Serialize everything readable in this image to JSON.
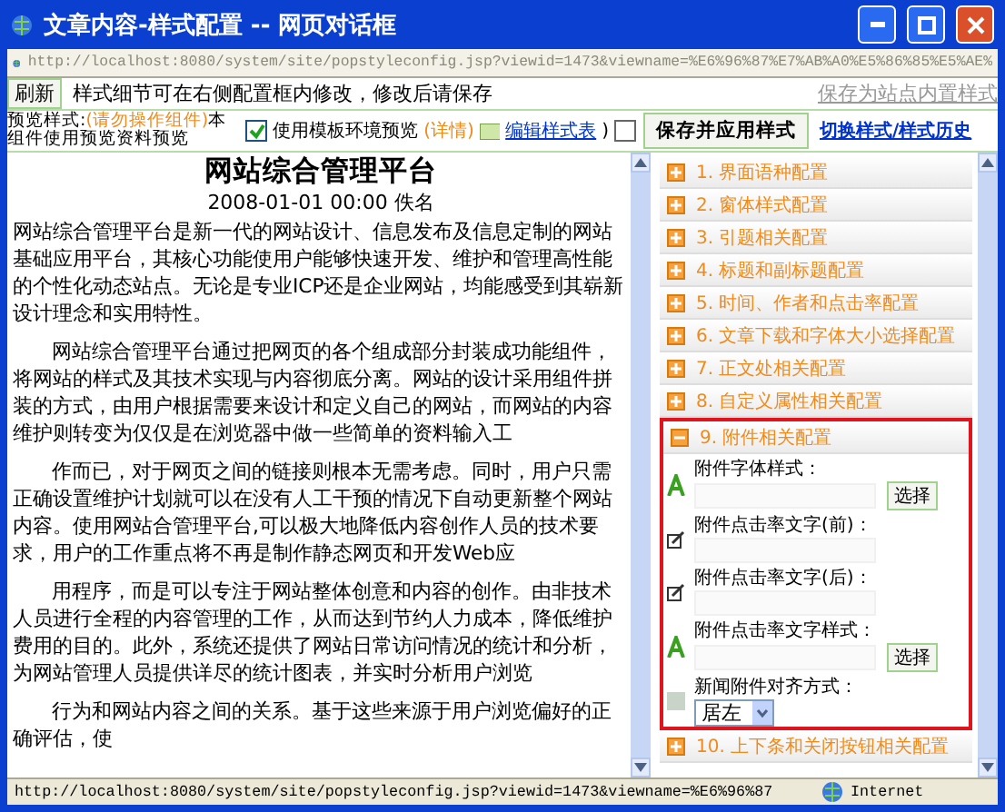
{
  "window": {
    "title": "文章内容-样式配置 -- 网页对话框"
  },
  "address": "http://localhost:8080/system/site/popstyleconfig.jsp?viewid=1473&viewname=%E6%96%87%E7%AB%A0%E5%86%85%E5%AE%",
  "toolbar": {
    "refresh": "刷新",
    "hint": "样式细节可在右侧配置框内修改，修改后请保存",
    "save_builtin": "保存为站点内置样式"
  },
  "preview_bar": {
    "label": "预览样式:",
    "warning": "(请勿操作组件)",
    "note": "本组件使用预览资料预览",
    "template_preview": {
      "label": "使用模板环境预览",
      "checked": true
    },
    "details": "(详情)",
    "edit_link": "编辑样式表",
    "close_paren": ")",
    "toggle_checked": false
  },
  "actions": {
    "save_apply": "保存并应用样式",
    "switch_link": "切换样式/样式历史"
  },
  "article": {
    "title": "网站综合管理平台",
    "meta": "2008-01-01 00:00 佚名",
    "paragraphs": [
      "网站综合管理平台是新一代的网站设计、信息发布及信息定制的网站基础应用平台，其核心功能使用户能够快速开发、维护和管理高性能的个性化动态站点。无论是专业ICP还是企业网站，均能感受到其崭新设计理念和实用特性。",
      "网站综合管理平台通过把网页的各个组成部分封装成功能组件，将网站的样式及其技术实现与内容彻底分离。网站的设计采用组件拼装的方式，由用户根据需要来设计和定义自己的网站，而网站的内容维护则转变为仅仅是在浏览器中做一些简单的资料输入工",
      "作而已，对于网页之间的链接则根本无需考虑。同时，用户只需正确设置维护计划就可以在没有人工干预的情况下自动更新整个网站内容。使用网站合管理平台,可以极大地降低内容创作人员的技术要求，用户的工作重点将不再是制作静态网页和开发Web应",
      "用程序，而是可以专注于网站整体创意和内容的创作。由非技术人员进行全程的内容管理的工作，从而达到节约人力成本，降低维护费用的目的。此外，系统还提供了网站日常访问情况的统计和分析，为网站管理人员提供详尽的统计图表，并实时分析用户浏览",
      "行为和网站内容之间的关系。基于这些来源于用户浏览偏好的正确评估，使"
    ]
  },
  "sections": [
    {
      "label": "1. 界面语种配置",
      "expanded": false
    },
    {
      "label": "2. 窗体样式配置",
      "expanded": false
    },
    {
      "label": "3. 引题相关配置",
      "expanded": false
    },
    {
      "label": "4. 标题和副标题配置",
      "expanded": false
    },
    {
      "label": "5. 时间、作者和点击率配置",
      "expanded": false
    },
    {
      "label": "6. 文章下载和字体大小选择配置",
      "expanded": false
    },
    {
      "label": "7. 正文处相关配置",
      "expanded": false
    },
    {
      "label": "8. 自定义属性相关配置",
      "expanded": false
    },
    {
      "label": "9. 附件相关配置",
      "expanded": true,
      "fields": [
        {
          "kind": "style",
          "label": "附件字体样式：",
          "button": "选择"
        },
        {
          "kind": "text",
          "label": "附件点击率文字(前)："
        },
        {
          "kind": "text",
          "label": "附件点击率文字(后)："
        },
        {
          "kind": "style",
          "label": "附件点击率文字样式：",
          "button": "选择"
        },
        {
          "kind": "select",
          "label": "新闻附件对齐方式：",
          "value": "居左"
        }
      ]
    },
    {
      "label": "10. 上下条和关闭按钮相关配置",
      "expanded": false
    }
  ],
  "status_bar": {
    "url": "http://localhost:8080/system/site/popstyleconfig.jsp?viewid=1473&viewname=%E6%96%87",
    "zone": "Internet"
  }
}
